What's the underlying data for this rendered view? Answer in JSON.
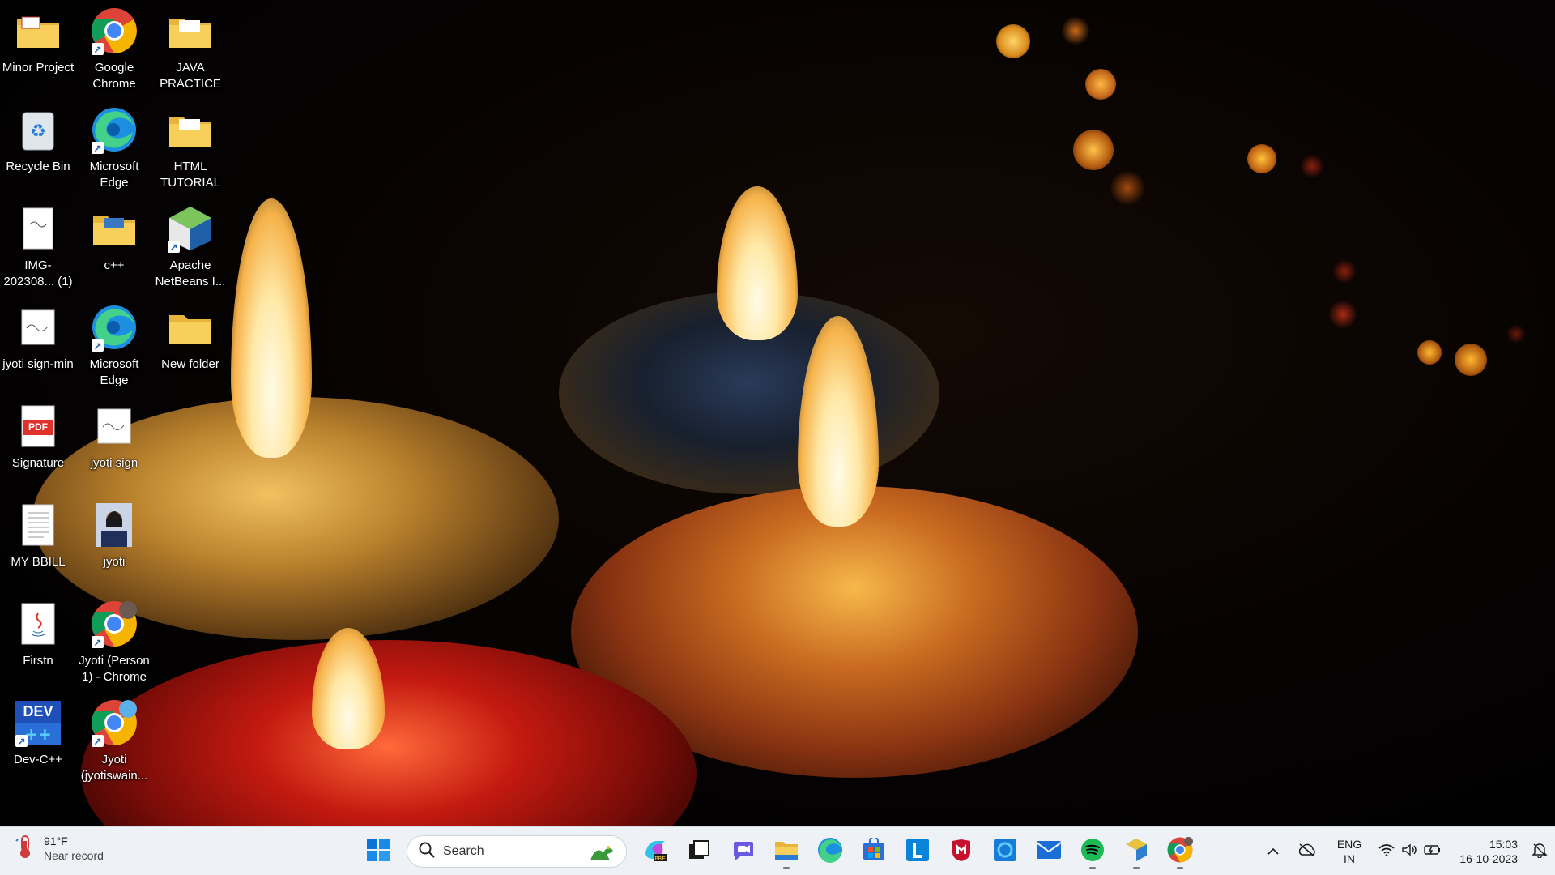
{
  "desktop": {
    "icons": [
      {
        "label": "Minor Project",
        "icon": "folder-icon"
      },
      {
        "label": "Google Chrome",
        "icon": "chrome-icon"
      },
      {
        "label": "JAVA PRACTICE",
        "icon": "folder-icon"
      },
      {
        "label": "Recycle Bin",
        "icon": "recycle-bin-icon"
      },
      {
        "label": "Microsoft Edge",
        "icon": "edge-icon"
      },
      {
        "label": "HTML TUTORIAL",
        "icon": "folder-icon"
      },
      {
        "label": "IMG-202308... (1)",
        "icon": "image-file-icon"
      },
      {
        "label": "c++",
        "icon": "folder-icon"
      },
      {
        "label": "Apache NetBeans I...",
        "icon": "netbeans-icon"
      },
      {
        "label": "jyoti sign-min",
        "icon": "image-file-icon"
      },
      {
        "label": "Microsoft Edge",
        "icon": "edge-icon"
      },
      {
        "label": "New folder",
        "icon": "folder-icon"
      },
      {
        "label": "Signature",
        "icon": "pdf-icon"
      },
      {
        "label": "jyoti sign",
        "icon": "image-file-icon"
      },
      {
        "label": "MY BBILL",
        "icon": "text-file-icon"
      },
      {
        "label": "jyoti",
        "icon": "photo-icon"
      },
      {
        "label": "Firstn",
        "icon": "java-file-icon"
      },
      {
        "label": "Jyoti (Person 1) - Chrome",
        "icon": "chrome-profile-icon"
      },
      {
        "label": "Dev-C++",
        "icon": "devcpp-icon"
      },
      {
        "label": "Jyoti (jyotiswain...",
        "icon": "chrome-profile-icon"
      }
    ],
    "pdf_badge": "PDF",
    "dev_badge": "DEV"
  },
  "taskbar": {
    "weather": {
      "temp": "91°F",
      "condition": "Near record",
      "icon": "thermometer-icon"
    },
    "search_placeholder": "Search",
    "pinned": [
      {
        "name": "start-button",
        "icon": "windows-logo-icon"
      },
      {
        "name": "copilot-button",
        "icon": "copilot-icon"
      },
      {
        "name": "task-view-button",
        "icon": "task-view-icon"
      },
      {
        "name": "teams-chat-button",
        "icon": "teams-chat-icon"
      },
      {
        "name": "file-explorer-button",
        "icon": "folder-icon",
        "running": true
      },
      {
        "name": "edge-button",
        "icon": "edge-icon"
      },
      {
        "name": "store-button",
        "icon": "store-icon"
      },
      {
        "name": "lens-button",
        "icon": "lens-icon"
      },
      {
        "name": "mcafee-button",
        "icon": "mcafee-icon"
      },
      {
        "name": "cortana-button",
        "icon": "cortana-icon"
      },
      {
        "name": "mail-button",
        "icon": "mail-icon"
      },
      {
        "name": "spotify-button",
        "icon": "spotify-icon",
        "running": true
      },
      {
        "name": "netbeans-button",
        "icon": "netbeans-icon",
        "running": true
      },
      {
        "name": "chrome-button",
        "icon": "chrome-icon",
        "running": true
      }
    ],
    "tray": {
      "lang_line1": "ENG",
      "lang_line2": "IN",
      "time": "15:03",
      "date": "16-10-2023"
    }
  }
}
